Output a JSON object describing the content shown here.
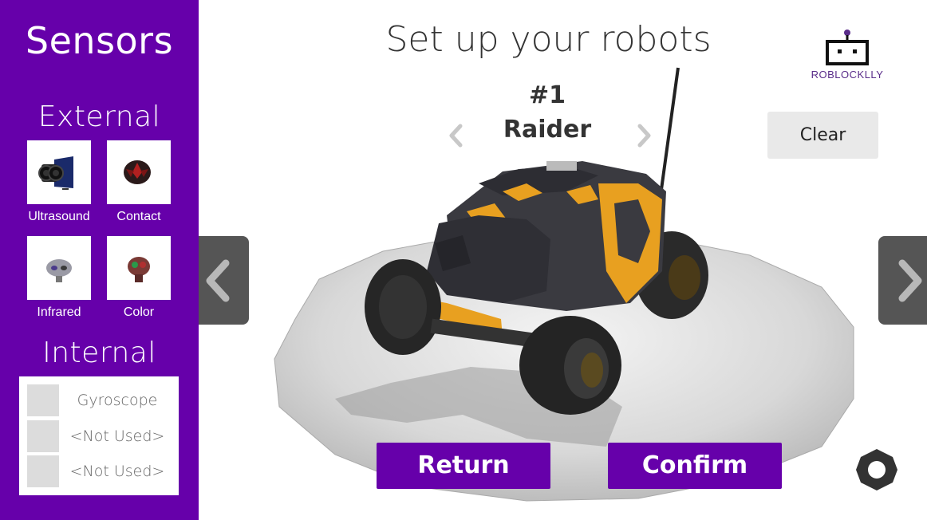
{
  "sidebar": {
    "title": "Sensors",
    "external_heading": "External",
    "external_sensors": [
      {
        "label": "Ultrasound",
        "icon": "ultrasound-sensor-icon"
      },
      {
        "label": "Contact",
        "icon": "contact-sensor-icon"
      },
      {
        "label": "Infrared",
        "icon": "infrared-sensor-icon"
      },
      {
        "label": "Color",
        "icon": "color-sensor-icon"
      }
    ],
    "internal_heading": "Internal",
    "internal_slots": [
      {
        "label": "Gyroscope"
      },
      {
        "label": "<Not Used>"
      },
      {
        "label": "<Not Used>"
      }
    ]
  },
  "main": {
    "title": "Set up your robots",
    "robot_number": "#1",
    "robot_name": "Raider",
    "clear_label": "Clear",
    "return_label": "Return",
    "confirm_label": "Confirm"
  },
  "logo": {
    "text": "ROBLOCKLLY",
    "icon": "robot-logo-icon"
  },
  "colors": {
    "accent": "#6600aa",
    "arrow_panel": "#555555",
    "clear_button": "#e9e9e9",
    "robot_body": "#3a3a40",
    "robot_trim": "#e8a020"
  }
}
